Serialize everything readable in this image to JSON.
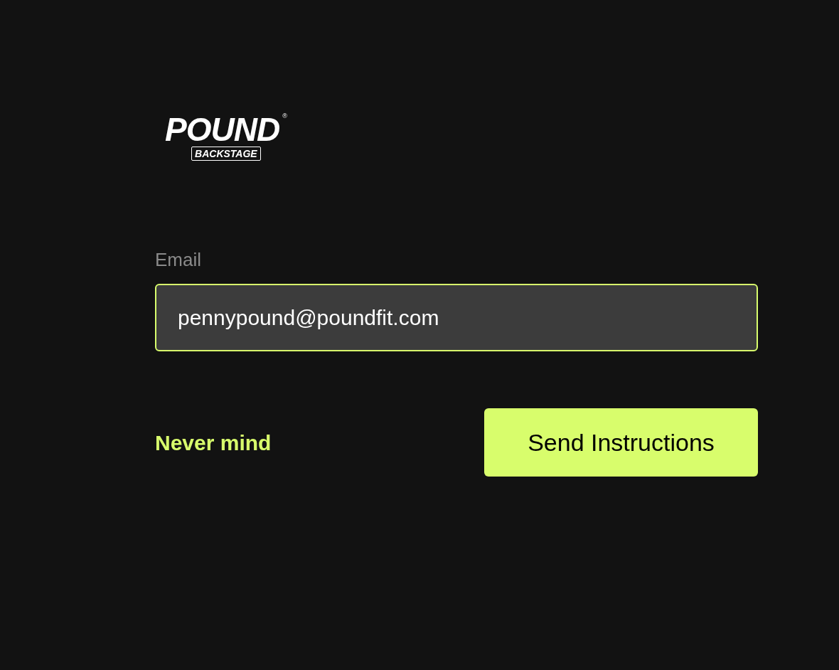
{
  "logo": {
    "wordmark": "POUND",
    "subtitle": "BACKSTAGE",
    "registered": "®"
  },
  "email": {
    "label": "Email",
    "value": "pennypound@poundfit.com",
    "focused": true
  },
  "cancel_link": "Never mind",
  "submit_button": "Send Instructions"
}
